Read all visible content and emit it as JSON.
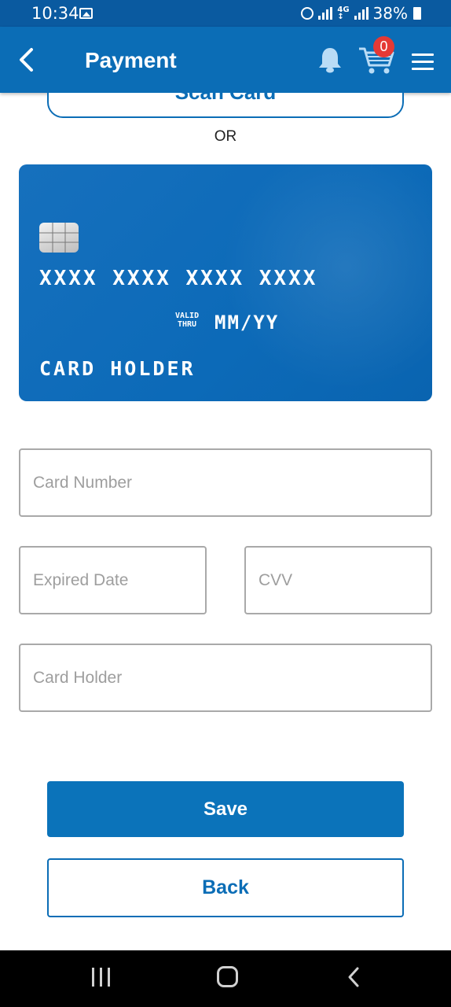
{
  "status_bar": {
    "time": "10:34",
    "battery": "38%"
  },
  "header": {
    "title": "Payment",
    "cart_count": "0"
  },
  "scan": {
    "label": "Scan Card"
  },
  "divider": {
    "or_text": "OR"
  },
  "card_preview": {
    "number_mask": "XXXX XXXX XXXX XXXX",
    "valid_label_line1": "VALID",
    "valid_label_line2": "THRU",
    "expiry_mask": "MM/YY",
    "holder_mask": "CARD HOLDER"
  },
  "form": {
    "card_number_placeholder": "Card Number",
    "expired_date_placeholder": "Expired Date",
    "cvv_placeholder": "CVV",
    "card_holder_placeholder": "Card Holder"
  },
  "actions": {
    "save_label": "Save",
    "back_label": "Back"
  },
  "colors": {
    "primary": "#0b6db6",
    "status_bar": "#0a5aa0",
    "badge": "#e53935",
    "nav_bar": "#000000"
  },
  "icons": [
    "image-icon",
    "alarm-icon",
    "signal-icon",
    "battery-icon",
    "back-arrow-icon",
    "bell-icon",
    "cart-icon",
    "menu-icon",
    "chip-icon",
    "recents-icon",
    "home-icon",
    "nav-back-icon"
  ]
}
